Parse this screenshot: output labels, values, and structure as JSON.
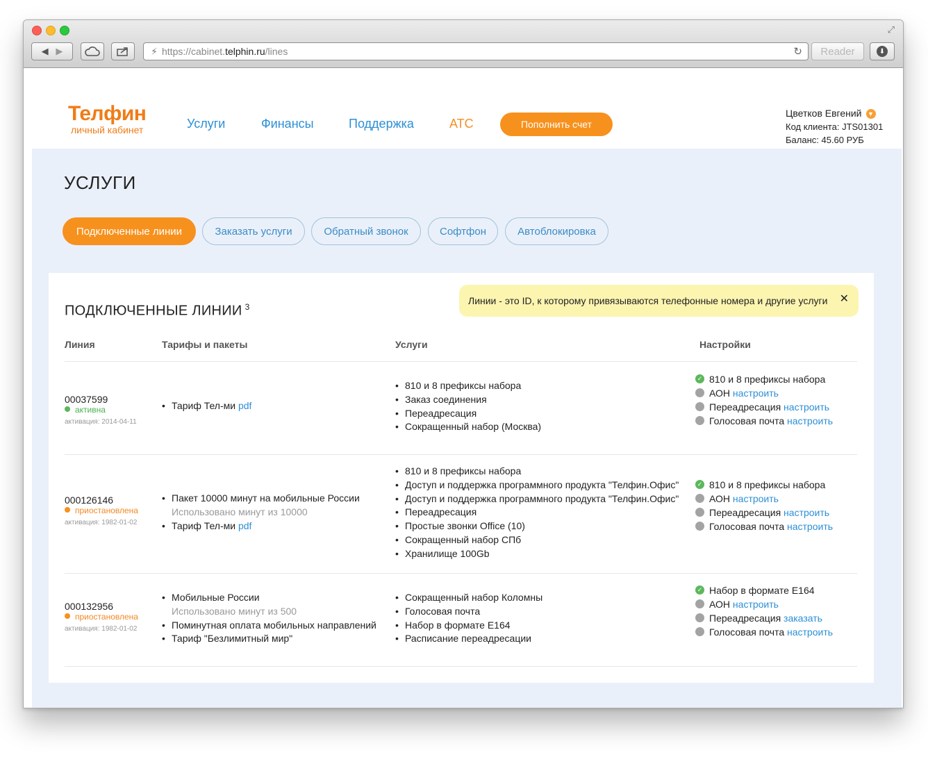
{
  "browser": {
    "url_prefix": "https://cabinet.",
    "url_host": "telphin.ru",
    "url_path": "/lines",
    "reader_label": "Reader"
  },
  "header": {
    "logo_name": "Телфин",
    "logo_sub": "личный кабинет",
    "nav": [
      "Услуги",
      "Финансы",
      "Поддержка",
      "АТС"
    ],
    "topup_label": "Пополнить счет",
    "user_name": "Цветков Евгений",
    "client_code": "Код клиента: JTS01301",
    "balance": "Баланс: 45.60 РУБ"
  },
  "page_title": "УСЛУГИ",
  "tabs": [
    "Подключенные линии",
    "Заказать услуги",
    "Обратный звонок",
    "Софтфон",
    "Автоблокировка"
  ],
  "card": {
    "title": "ПОДКЛЮЧЕННЫЕ ЛИНИИ",
    "count": "3",
    "tip": "Линии - это ID, к которому привязываются телефонные номера и другие услуги",
    "tip_close": "✕",
    "columns": [
      "Линия",
      "Тарифы и пакеты",
      "Услуги",
      "Настройки"
    ]
  },
  "lines": [
    {
      "id": "00037599",
      "status": "активна",
      "activation": "активация: 2014-04-11",
      "tariffs": [
        {
          "text": "Тариф Тел-ми ",
          "link": "pdf"
        }
      ],
      "services": [
        "810 и 8 префиксы набора",
        "Заказ соединения",
        "Переадресация",
        "Сокращенный набор (Москва)"
      ],
      "settings": [
        {
          "text": "810 и 8 префиксы набора",
          "link": ""
        },
        {
          "text": "АОН ",
          "link": "настроить"
        },
        {
          "text": "Переадресация ",
          "link": "настроить"
        },
        {
          "text": "Голосовая почта ",
          "link": "настроить"
        }
      ]
    },
    {
      "id": "000126146",
      "status": "приостановлена",
      "activation": "активация: 1982-01-02",
      "tariffs": [
        {
          "text": "Пакет 10000 минут на мобильные России",
          "sub": "Использовано минут из 10000"
        },
        {
          "text": "Тариф Тел-ми ",
          "link": "pdf"
        }
      ],
      "services": [
        "810 и 8 префиксы набора",
        "Доступ и поддержка программного продукта \"Телфин.Офис\"",
        "Доступ и поддержка программного продукта \"Телфин.Офис\"",
        "Переадресация",
        "Простые звонки Office (10)",
        "Сокращенный набор СПб",
        "Хранилище 100Gb"
      ],
      "settings": [
        {
          "text": "810 и 8 префиксы набора",
          "link": ""
        },
        {
          "text": "АОН ",
          "link": "настроить"
        },
        {
          "text": "Переадресация ",
          "link": "настроить"
        },
        {
          "text": "Голосовая почта ",
          "link": "настроить"
        }
      ]
    },
    {
      "id": "000132956",
      "status": "приостановлена",
      "activation": "активация: 1982-01-02",
      "tariffs": [
        {
          "text": "Мобильные России",
          "sub": "Использовано минут из 500"
        },
        {
          "text": "Поминутная оплата мобильных направлений"
        },
        {
          "text": "Тариф \"Безлимитный мир\""
        }
      ],
      "services": [
        "Сокращенный набор Коломны",
        "Голосовая почта",
        "Набор в формате E164",
        "Расписание переадресации"
      ],
      "settings": [
        {
          "text": "Набор в формате E164",
          "link": ""
        },
        {
          "text": "АОН ",
          "link": "настроить"
        },
        {
          "text": "Переадресация ",
          "link": "заказать"
        },
        {
          "text": "Голосовая почта ",
          "link": "настроить"
        }
      ]
    }
  ]
}
